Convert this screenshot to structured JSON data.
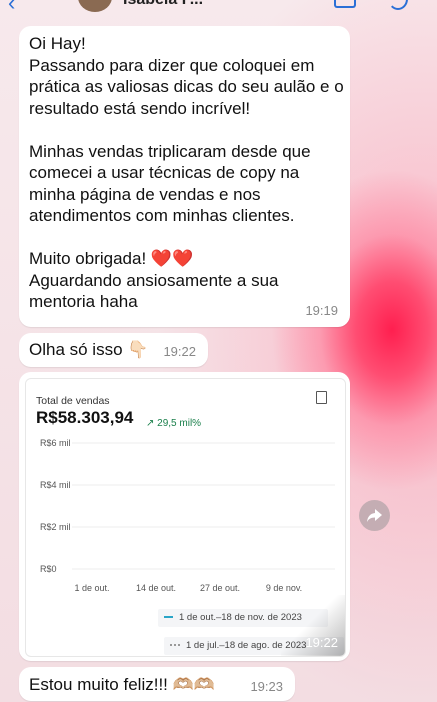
{
  "header": {
    "contact_name": "Isabela F..."
  },
  "messages": {
    "m1": {
      "text": "Oi Hay!\nPassando para dizer que coloquei em prática as valiosas dicas do seu aulão e o resultado está sendo incrível!\n\nMinhas vendas triplicaram desde que comecei a usar técnicas de copy na minha página de vendas e nos atendimentos com minhas clientes.\n\nMuito obrigada! ",
      "hearts": "❤️❤️",
      "text2": "\nAguardando ansiosamente a sua mentoria haha",
      "time": "19:19"
    },
    "m2": {
      "text": "Olha só isso 👇🏻",
      "time": "19:22"
    },
    "m3": {
      "time": "19:22"
    },
    "m4": {
      "text": "Estou muito feliz!!! 🫶🏼🫶🏼",
      "time": "19:23"
    }
  },
  "sales_card": {
    "label": "Total de vendas",
    "total": "R$58.303,94",
    "delta": "↗ 29,5 mil%",
    "legend_current": "1 de out.–18 de nov. de 2023",
    "legend_previous": "1 de jul.–18 de ago. de 2023"
  },
  "chart_data": {
    "type": "line",
    "title": "Total de vendas",
    "y_tick_labels": [
      "R$6 mil",
      "R$4 mil",
      "R$2 mil",
      "R$0"
    ],
    "x_tick_labels": [
      "1 de out.",
      "14 de out.",
      "27 de out.",
      "9 de nov."
    ],
    "ylim": [
      0,
      6000
    ],
    "grid": true,
    "series": [
      {
        "name": "1 de out.–18 de nov. de 2023",
        "values": []
      },
      {
        "name": "1 de jul.–18 de ago. de 2023",
        "values": []
      }
    ],
    "colors": {
      "current": "#2aa5c7",
      "previous": "#999999"
    }
  },
  "icons": {
    "share": "share-arrow-icon",
    "document": "document-icon"
  }
}
